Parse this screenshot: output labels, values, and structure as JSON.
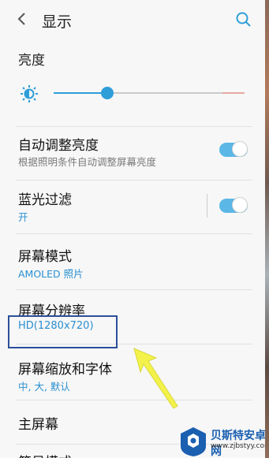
{
  "header": {
    "title": "显示"
  },
  "brightness": {
    "title": "亮度",
    "level_fraction": 0.28
  },
  "settings": [
    {
      "title": "自动调整亮度",
      "subtitle": "根据照明条件自动调整屏幕亮度",
      "toggle": true
    },
    {
      "title": "蓝光过滤",
      "subtitle": "开",
      "toggle": true
    },
    {
      "title": "屏幕模式",
      "subtitle": "AMOLED 照片"
    },
    {
      "title": "屏幕分辨率",
      "subtitle": "HD(1280x720)"
    },
    {
      "title": "屏幕缩放和字体",
      "subtitle": "中, 大, 默认"
    },
    {
      "title": "主屏幕"
    },
    {
      "title": "简易模式"
    }
  ],
  "watermark": {
    "name": "贝斯特安卓网",
    "url": "www.zjbstyy.com"
  },
  "colors": {
    "accent": "#2e9ed8",
    "toggle": "#5ab7e6",
    "highlight": "#2c4f9a",
    "arrow": "#f2f24a"
  }
}
